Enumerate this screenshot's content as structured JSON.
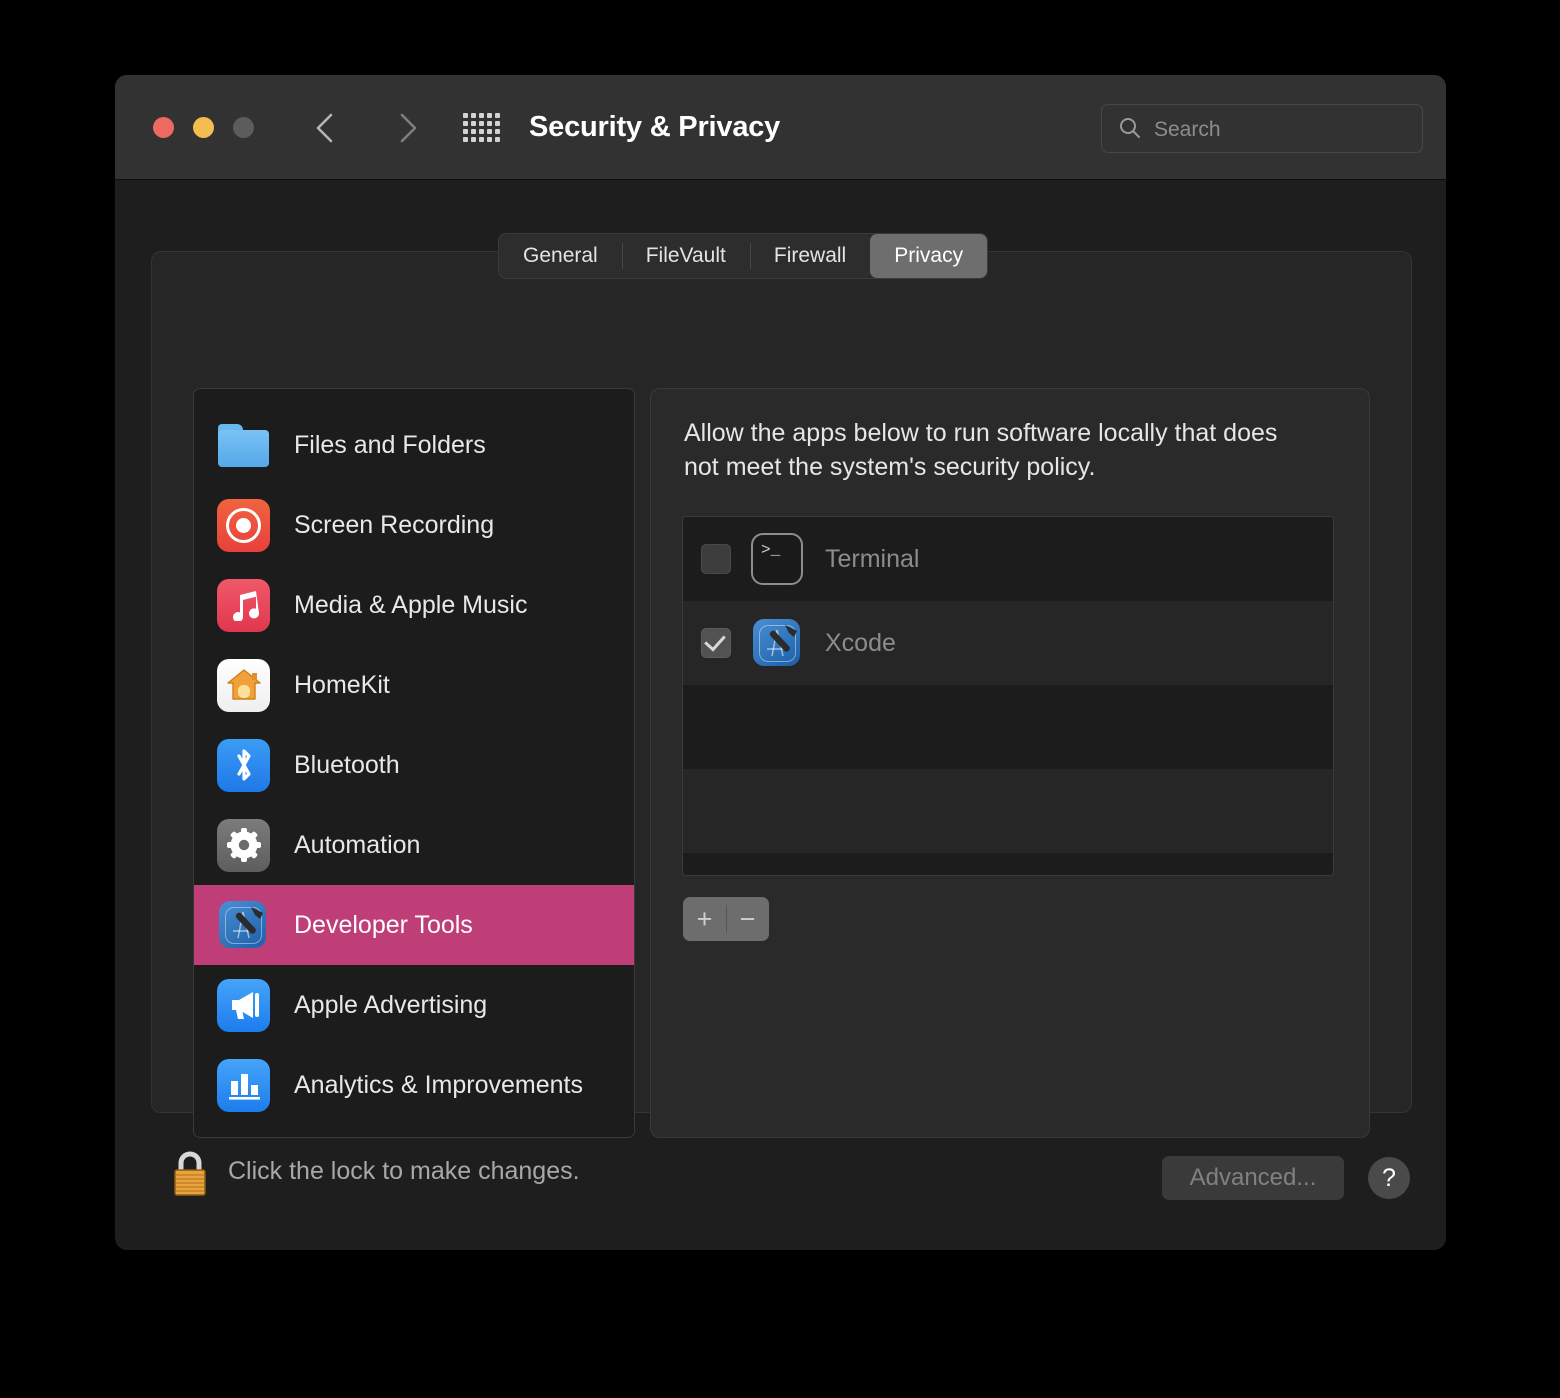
{
  "window": {
    "title": "Security & Privacy",
    "traffic_lights": {
      "close": "close-button",
      "minimize": "minimize-button",
      "maximize": "maximize-button"
    },
    "nav": {
      "back": "back-chevron",
      "forward": "forward-chevron",
      "grid": "show-all-grid"
    },
    "search": {
      "placeholder": "Search",
      "value": ""
    }
  },
  "tabs": [
    {
      "label": "General",
      "active": false
    },
    {
      "label": "FileVault",
      "active": false
    },
    {
      "label": "Firewall",
      "active": false
    },
    {
      "label": "Privacy",
      "active": true
    }
  ],
  "sidebar": {
    "items": [
      {
        "label": "",
        "icon": "folder-icon",
        "selected": false,
        "partial": true
      },
      {
        "label": "Files and Folders",
        "icon": "folder-icon",
        "selected": false
      },
      {
        "label": "Screen Recording",
        "icon": "screen-recording-icon",
        "selected": false
      },
      {
        "label": "Media & Apple Music",
        "icon": "music-note-icon",
        "selected": false
      },
      {
        "label": "HomeKit",
        "icon": "homekit-house-icon",
        "selected": false
      },
      {
        "label": "Bluetooth",
        "icon": "bluetooth-icon",
        "selected": false
      },
      {
        "label": "Automation",
        "icon": "gear-icon",
        "selected": false
      },
      {
        "label": "Developer Tools",
        "icon": "xcode-hammer-icon",
        "selected": true
      },
      {
        "label": "Apple Advertising",
        "icon": "megaphone-icon",
        "selected": false
      },
      {
        "label": "Analytics & Improvements",
        "icon": "bar-chart-icon",
        "selected": false
      }
    ]
  },
  "detail": {
    "description": "Allow the apps below to run software locally that does not meet the system's security policy.",
    "apps": [
      {
        "name": "Terminal",
        "icon": "terminal-icon",
        "checked": false
      },
      {
        "name": "Xcode",
        "icon": "xcode-icon",
        "checked": true
      },
      {
        "name": "",
        "icon": "",
        "checked": false
      },
      {
        "name": "",
        "icon": "",
        "checked": false
      },
      {
        "name": "",
        "icon": "",
        "checked": false
      }
    ],
    "add_label": "+",
    "remove_label": "−"
  },
  "footer": {
    "lock_text": "Click the lock to make changes.",
    "lock_icon": "locked-padlock-icon",
    "advanced_label": "Advanced...",
    "help_label": "?"
  },
  "colors": {
    "selection": "#bf3e78",
    "window_bg": "#1e1e1e",
    "titlebar_bg": "#323232",
    "panel_bg": "#262626",
    "list_bg": "#1c1c1c",
    "accent_blue": "#1d7ced"
  }
}
